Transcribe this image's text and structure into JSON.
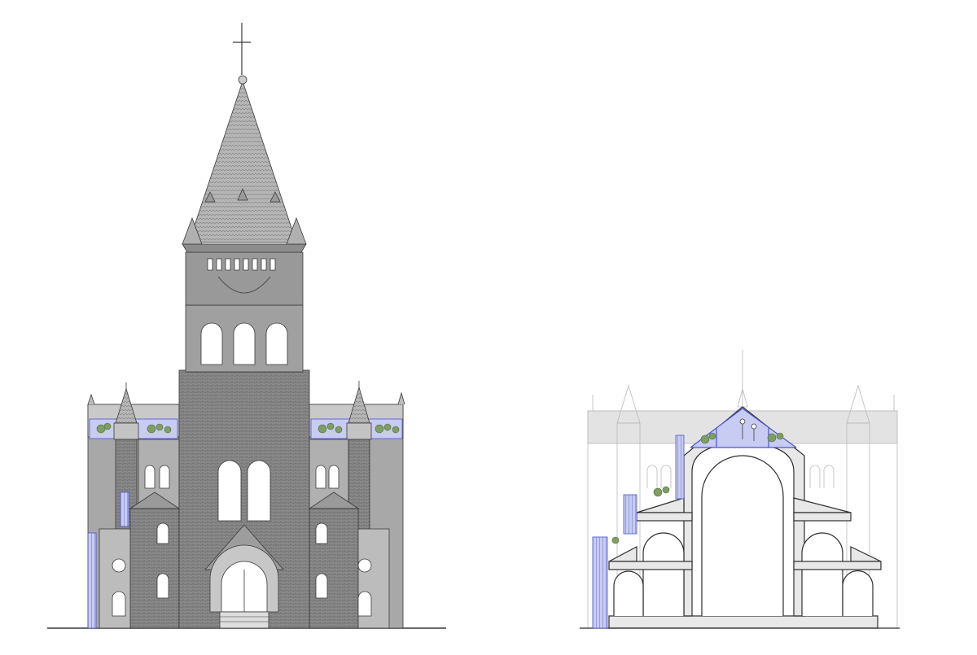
{
  "drawing": {
    "views": [
      {
        "id": "front-elevation"
      },
      {
        "id": "cross-section"
      }
    ],
    "colors": {
      "background": "#ffffff",
      "line": "#3a3a3a",
      "fill_dark": "#7a7a7a",
      "fill_mid": "#a5a5a5",
      "fill_light": "#cfcfcf",
      "cut_fill": "#e8e8e8",
      "ghost_line": "#b9b9b9",
      "proposal_blue": "#4a54c8",
      "proposal_blue_light": "#c8ccf2",
      "planting_green": "#7f9e63"
    },
    "icons": [
      "cross-icon",
      "person-icon",
      "planter-icon",
      "ladder-icon"
    ]
  }
}
